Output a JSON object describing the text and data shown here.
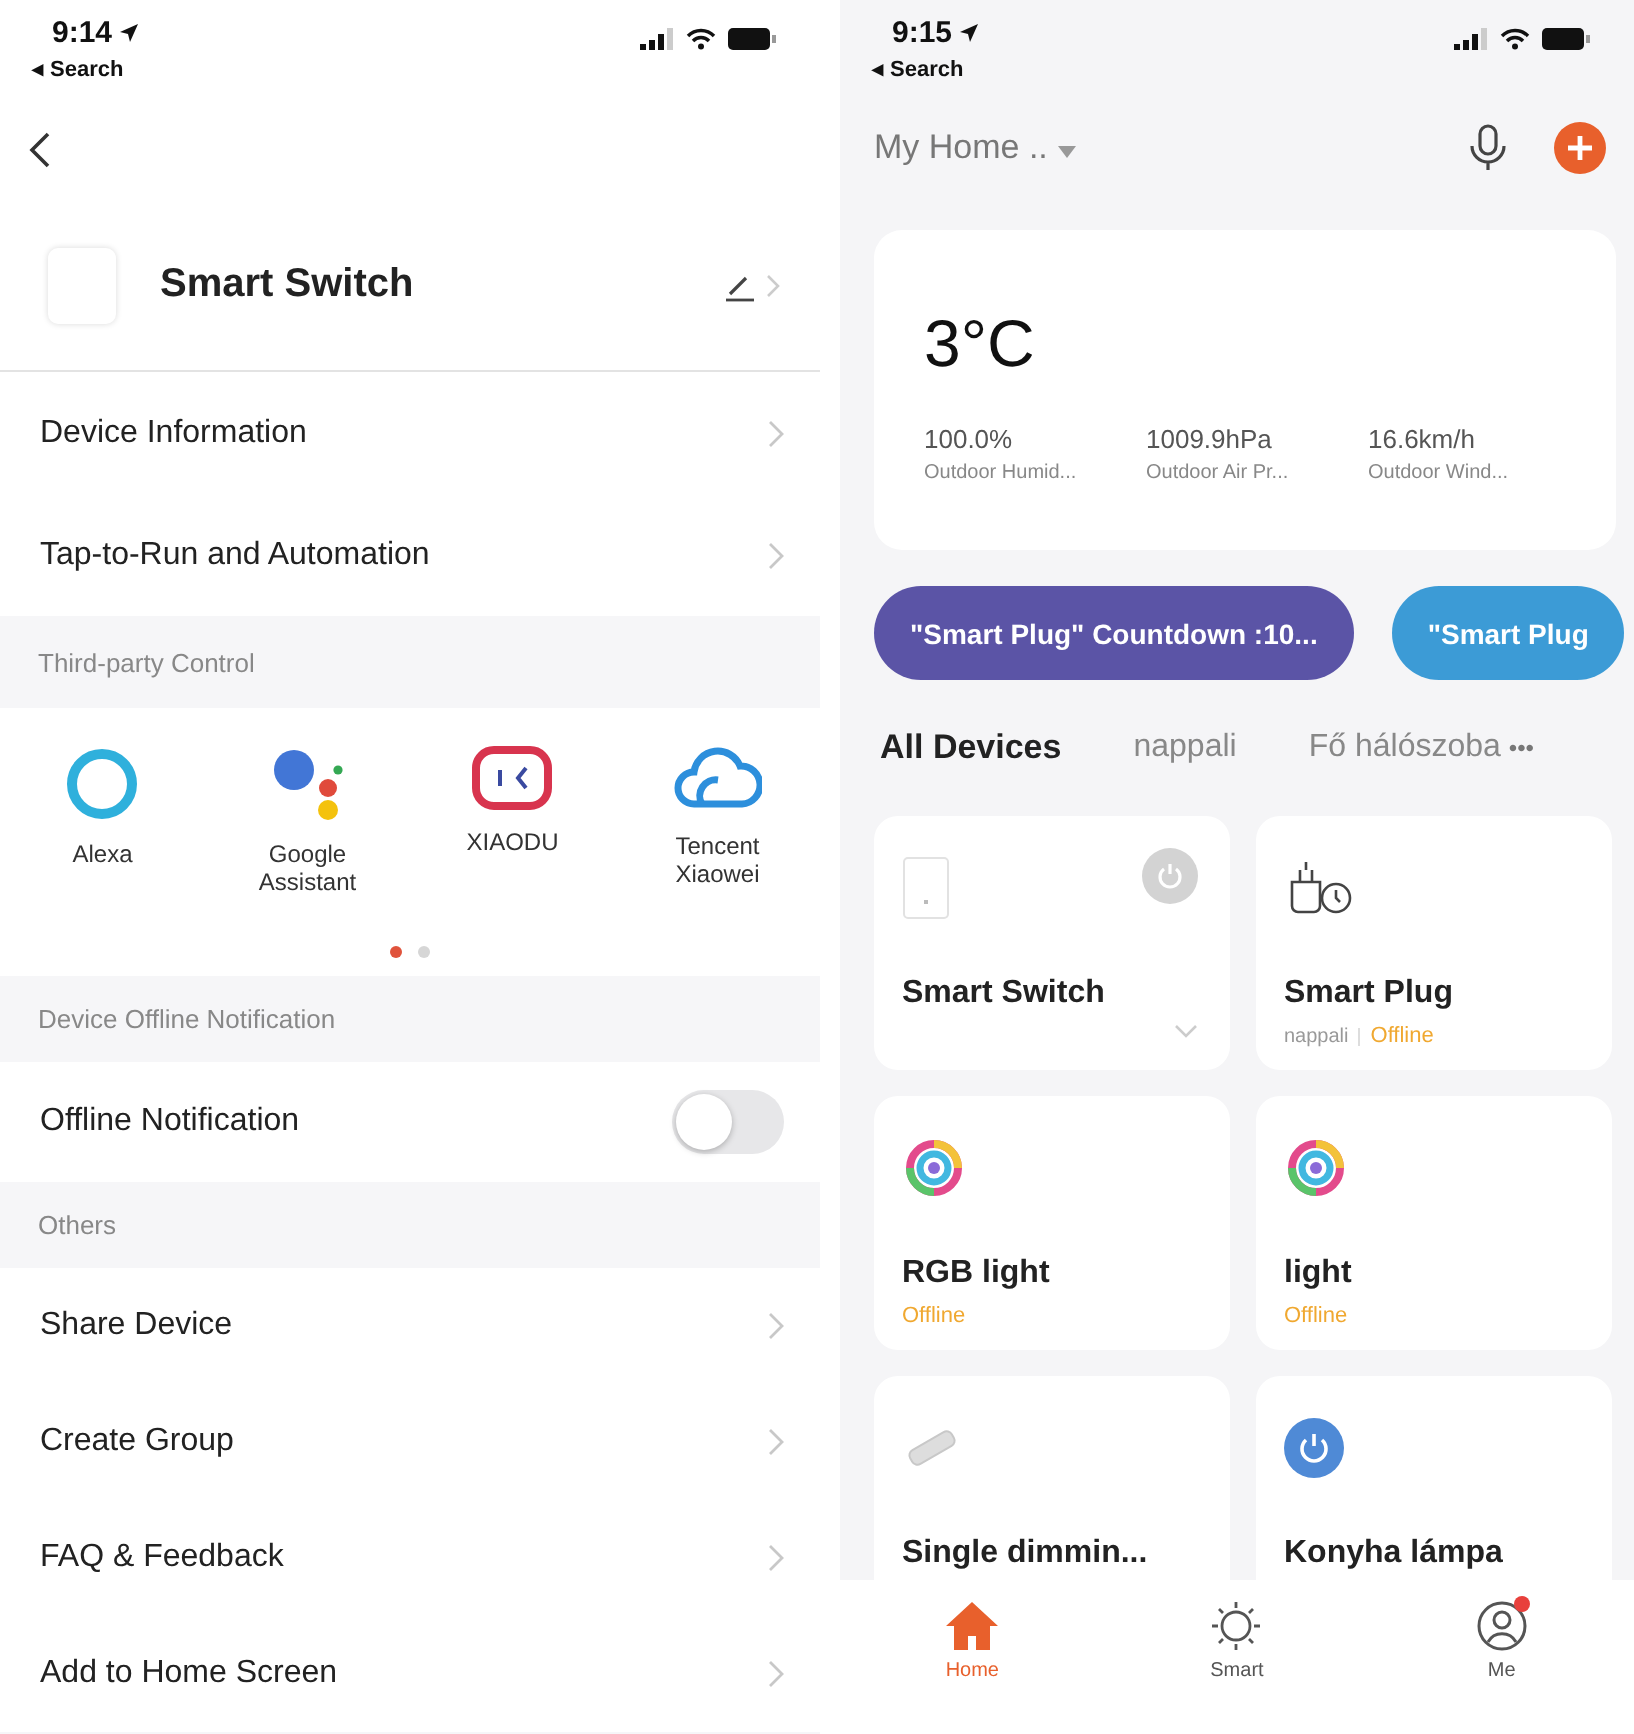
{
  "left": {
    "status_bar": {
      "time": "9:14",
      "back_app": "◂ Search"
    },
    "device": {
      "name": "Smart Switch"
    },
    "rows_top": [
      "Device Information",
      "Tap-to-Run and Automation"
    ],
    "third_party": {
      "header": "Third-party Control",
      "items": [
        {
          "kind": "alexa",
          "label": "Alexa"
        },
        {
          "kind": "google",
          "label": "Google Assistant"
        },
        {
          "kind": "xiaodu",
          "label": "XIAODU"
        },
        {
          "kind": "tencent",
          "label": "Tencent Xiaowei"
        }
      ],
      "page_dots": [
        {
          "selected": true
        },
        {
          "selected": false
        }
      ]
    },
    "offline": {
      "header": "Device Offline Notification",
      "label": "Offline Notification",
      "on": false
    },
    "others": {
      "header": "Others",
      "rows": [
        "Share Device",
        "Create Group",
        "FAQ & Feedback",
        "Add to Home Screen"
      ]
    }
  },
  "right": {
    "status_bar": {
      "time": "9:15",
      "back_app": "◂ Search"
    },
    "home_selector": "My Home ..",
    "weather": {
      "temperature": "3°C",
      "stats": [
        {
          "value": "100.0%",
          "label": "Outdoor Humid..."
        },
        {
          "value": "1009.9hPa",
          "label": "Outdoor Air Pr..."
        },
        {
          "value": "16.6km/h",
          "label": "Outdoor Wind..."
        }
      ]
    },
    "scenes": [
      {
        "label": "\"Smart Plug\" Countdown :10...",
        "color": "#5b54a6"
      },
      {
        "label": "\"Smart Plug",
        "color": "#3c9bd6"
      }
    ],
    "rooms": [
      {
        "label": "All Devices",
        "selected": true
      },
      {
        "label": "nappali",
        "selected": false
      },
      {
        "label": "Fő hálószoba",
        "selected": false
      }
    ],
    "more": "•••",
    "devices": [
      {
        "kind": "switch",
        "name": "Smart Switch",
        "power_button": true
      },
      {
        "kind": "plug",
        "name": "Smart Plug",
        "power_button": false,
        "room": "nappali",
        "status": "Offline"
      },
      {
        "kind": "rgb",
        "name": "RGB light",
        "power_button": false,
        "status": "Offline"
      },
      {
        "kind": "rgb",
        "name": "light",
        "power_button": false,
        "status": "Offline"
      },
      {
        "kind": "strip",
        "name": "Single dimmin...",
        "power_button": false
      },
      {
        "kind": "power",
        "name": "Konyha lámpa",
        "power_button": false
      }
    ],
    "tab_bar": [
      {
        "kind": "home",
        "label": "Home",
        "selected": true,
        "badge": false
      },
      {
        "kind": "smart",
        "label": "Smart",
        "selected": false,
        "badge": false
      },
      {
        "kind": "me",
        "label": "Me",
        "selected": false,
        "badge": true
      }
    ]
  }
}
